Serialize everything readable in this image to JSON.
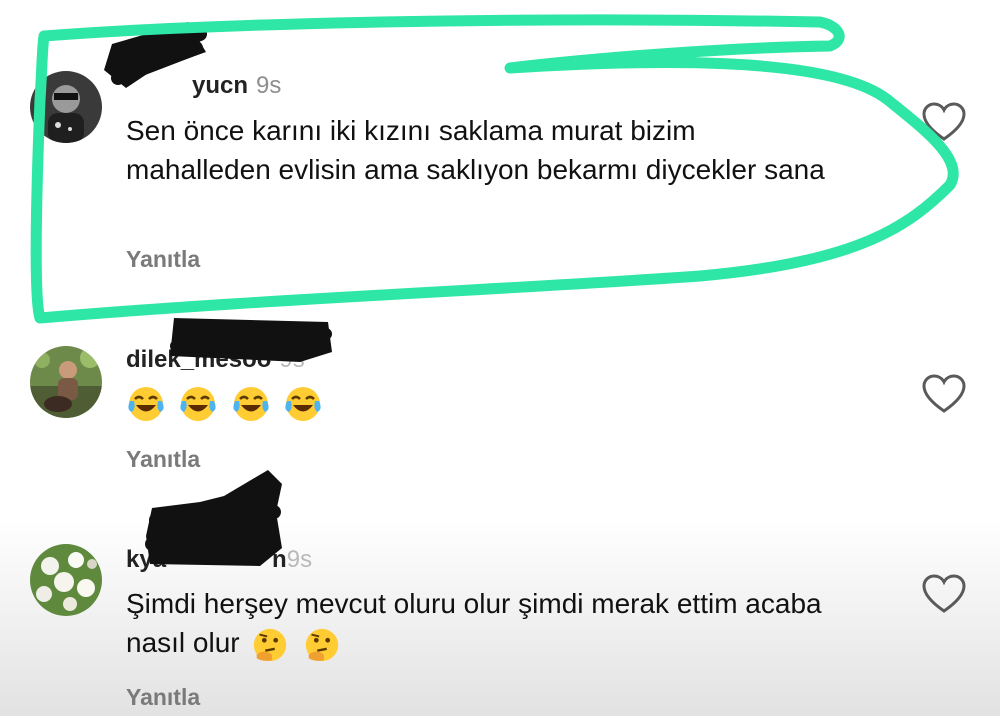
{
  "comments": [
    {
      "username": "yucn",
      "time": "9s",
      "text": "Sen önce karını iki kızını saklama murat bizim mahalleden evlisin ama saklıyon bekarmı diycekler sana",
      "reply_label": "Yanıtla",
      "avatar_icon": "avatar-dark-photo"
    },
    {
      "username": "dilek_mesoo",
      "time": "9s",
      "emoji": [
        "face-with-tears-of-joy",
        "face-with-tears-of-joy",
        "face-with-tears-of-joy",
        "face-with-tears-of-joy"
      ],
      "reply_label": "Yanıtla",
      "avatar_icon": "avatar-outdoor-photo"
    },
    {
      "username": "kya",
      "username_suffix": "n",
      "time": "9s",
      "text": "Şimdi herşey mevcut oluru olur şimdi merak ettim acaba nasıl olur",
      "emoji_trailing": [
        "thinking-face",
        "thinking-face"
      ],
      "reply_label": "Yanıtla",
      "avatar_icon": "avatar-flowers-photo"
    }
  ],
  "highlight_color": "#2ee6a6",
  "redaction_color": "#111111"
}
